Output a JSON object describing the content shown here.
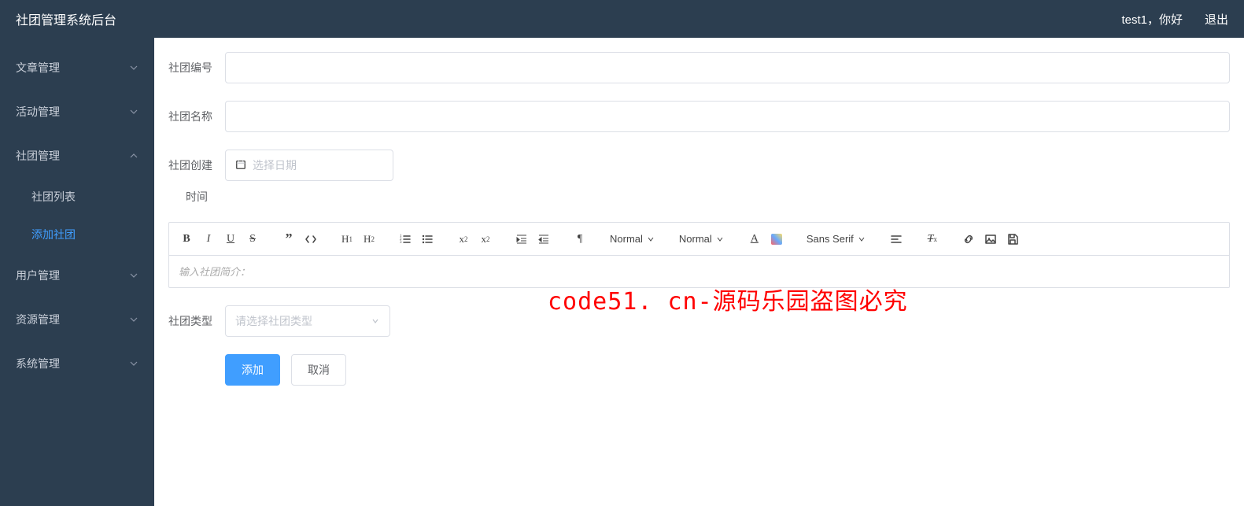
{
  "header": {
    "title": "社团管理系统后台",
    "greeting": "test1，你好",
    "logout": "退出"
  },
  "sidebar": {
    "items": [
      {
        "label": "文章管理",
        "expanded": false
      },
      {
        "label": "活动管理",
        "expanded": false
      },
      {
        "label": "社团管理",
        "expanded": true,
        "children": [
          {
            "label": "社团列表",
            "active": false
          },
          {
            "label": "添加社团",
            "active": true
          }
        ]
      },
      {
        "label": "用户管理",
        "expanded": false
      },
      {
        "label": "资源管理",
        "expanded": false
      },
      {
        "label": "系统管理",
        "expanded": false
      }
    ]
  },
  "form": {
    "club_id_label": "社团编号",
    "club_id_value": "",
    "club_name_label": "社团名称",
    "club_name_value": "",
    "created_label_line1": "社团创建",
    "created_label_line2": "时间",
    "date_placeholder": "选择日期",
    "intro_placeholder": "输入社团简介：",
    "type_label": "社团类型",
    "type_placeholder": "请选择社团类型",
    "submit": "添加",
    "cancel": "取消"
  },
  "toolbar": {
    "h1": "H₁",
    "h2": "H₂",
    "normal1": "Normal",
    "normal2": "Normal",
    "font": "Sans Serif"
  },
  "watermark": "code51. cn-源码乐园盗图必究"
}
